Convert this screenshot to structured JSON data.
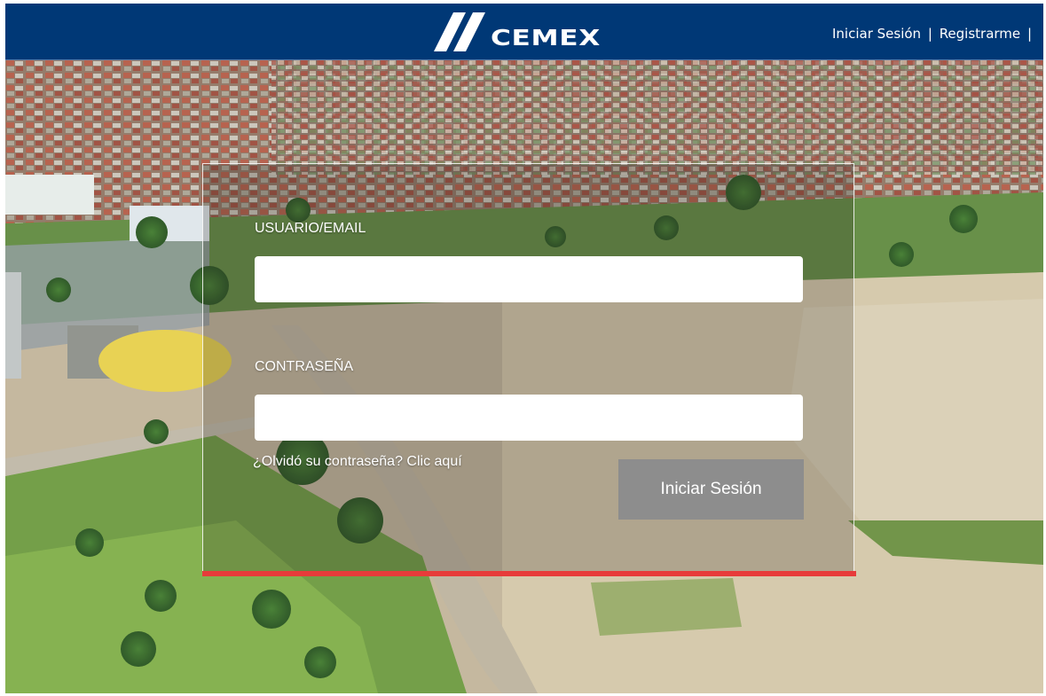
{
  "header": {
    "logo_text": "CEMEX",
    "nav": {
      "login_label": "Iniciar Sesión",
      "separator": "|",
      "register_label": "Registrarme"
    }
  },
  "login_form": {
    "username_label": "USUARIO/EMAIL",
    "username_value": "",
    "password_label": "CONTRASEÑA",
    "password_value": "",
    "forgot_password_link": "¿Olvidó su contraseña? Clic aquí",
    "submit_label": "Iniciar Sesión"
  },
  "colors": {
    "header_bg": "#003876",
    "accent_bar": "#e73b3a",
    "submit_bg": "#8d8d8d"
  },
  "icons": {
    "logo_mark": "cemex-double-slash-logo"
  }
}
